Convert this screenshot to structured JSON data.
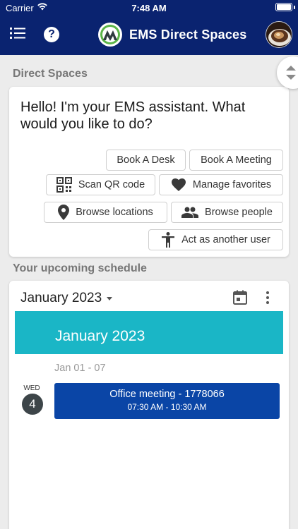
{
  "status_bar": {
    "carrier": "Carrier",
    "time": "7:48 AM"
  },
  "header": {
    "title": "EMS Direct Spaces",
    "icons": {
      "menu": "menu-icon",
      "help": "help-icon",
      "logo": "ems-logo",
      "avatar": "coffee-avatar"
    }
  },
  "direct_spaces": {
    "section_title": "Direct Spaces",
    "greeting": "Hello! I'm your EMS assistant. What would you like to do?",
    "actions": {
      "book_desk": "Book A Desk",
      "book_meeting": "Book A Meeting",
      "scan_qr": "Scan QR code",
      "manage_favorites": "Manage favorites",
      "browse_locations": "Browse locations",
      "browse_people": "Browse people",
      "act_as_user": "Act as another user"
    }
  },
  "schedule": {
    "section_title": "Your upcoming schedule",
    "month_selector": "January 2023",
    "month_banner": "January 2023",
    "week_range": "Jan 01 - 07",
    "day": {
      "weekday": "WED",
      "number": "4"
    },
    "event": {
      "title": "Office meeting - 1778066",
      "time": "07:30 AM - 10:30 AM"
    }
  },
  "colors": {
    "header": "#0a2370",
    "month_banner": "#1ab6c6",
    "event": "#0a45a6",
    "logo_green": "#5bb548"
  }
}
